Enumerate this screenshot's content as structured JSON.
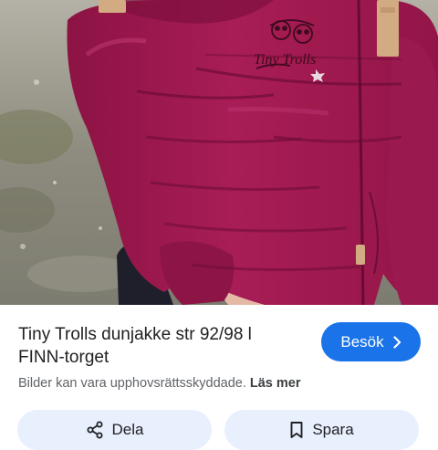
{
  "image": {
    "alt": "Tiny Trolls dunjakke str 92/98 l FINN-torget",
    "logo_text": "Tiny Trolls",
    "colors": {
      "jacket": "#a0194f",
      "jacket_dark": "#6e0d35",
      "tag": "#d2ab82",
      "ground": "#8f8f86"
    }
  },
  "result": {
    "title_line1": "Tiny Trolls dunjakke str 92/98 l",
    "title_line2": "FINN-torget",
    "visit_label": "Besök",
    "copyright_text": "Bilder kan vara upphovsrättsskyddade.",
    "read_more_label": "Läs mer"
  },
  "actions": {
    "share_label": "Dela",
    "save_label": "Spara"
  },
  "icons": {
    "visit": "chevron-right-icon",
    "share": "share-icon",
    "save": "bookmark-icon"
  },
  "colors": {
    "accent": "#1a73e8",
    "action_bg": "#e8f0fe",
    "text": "#202124",
    "secondary_text": "#5f6368"
  }
}
